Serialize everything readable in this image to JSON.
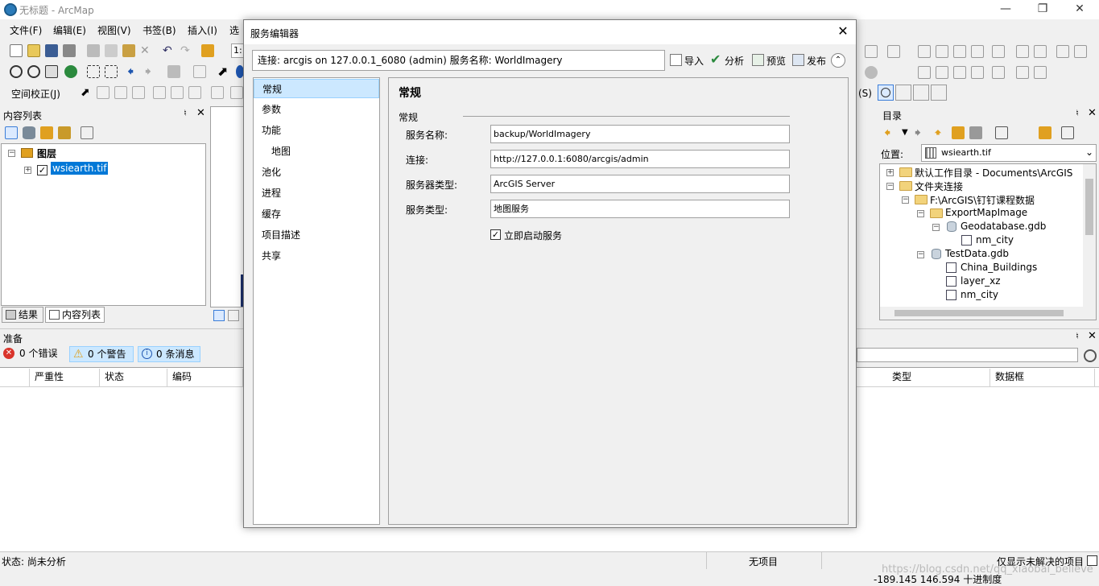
{
  "window": {
    "title": "无标题 - ArcMap"
  },
  "menu": [
    "文件(F)",
    "编辑(E)",
    "视图(V)",
    "书签(B)",
    "插入(I)",
    "选"
  ],
  "toolbar": {
    "scale_value": "1:",
    "spatial_adjust_label": "空间校正(J)",
    "s_label": "(S)"
  },
  "toc": {
    "title": "内容列表",
    "layers_label": "图层",
    "layer_name": "wsiearth.tif",
    "tabs": [
      "结果",
      "内容列表"
    ]
  },
  "prepare": {
    "title": "准备",
    "errors": "0 个错误",
    "warnings": "0 个警告",
    "messages": "0 条消息",
    "columns": [
      "严重性",
      "状态",
      "编码",
      "类型",
      "数据框"
    ]
  },
  "catalog": {
    "title": "目录",
    "location_label": "位置:",
    "location_value": "wsiearth.tif",
    "items": [
      {
        "label": "默认工作目录 - Documents\\ArcGIS"
      },
      {
        "label": "文件夹连接"
      },
      {
        "label": "F:\\ArcGIS\\钉钉课程数据"
      },
      {
        "label": "ExportMapImage"
      },
      {
        "label": "Geodatabase.gdb"
      },
      {
        "label": "nm_city"
      },
      {
        "label": "TestData.gdb"
      },
      {
        "label": "China_Buildings"
      },
      {
        "label": "layer_xz"
      },
      {
        "label": "nm_city"
      }
    ]
  },
  "dialog": {
    "title": "服务编辑器",
    "connection_text": "连接: arcgis on 127.0.0.1_6080 (admin)   服务名称: WorldImagery",
    "tools": {
      "import": "导入",
      "analyze": "分析",
      "preview": "预览",
      "publish": "发布"
    },
    "nav": [
      {
        "label": "常规"
      },
      {
        "label": "参数"
      },
      {
        "label": "功能"
      },
      {
        "label": "地图"
      },
      {
        "label": "池化"
      },
      {
        "label": "进程"
      },
      {
        "label": "缓存"
      },
      {
        "label": "项目描述"
      },
      {
        "label": "共享"
      }
    ],
    "content_title": "常规",
    "group_title": "常规",
    "fields": [
      {
        "label": "服务名称:",
        "value": "backup/WorldImagery"
      },
      {
        "label": "连接:",
        "value": "http://127.0.0.1:6080/arcgis/admin"
      },
      {
        "label": "服务器类型:",
        "value": "ArcGIS Server"
      },
      {
        "label": "服务类型:",
        "value": "地图服务"
      }
    ],
    "start_immediately_label": "立即启动服务",
    "start_immediately_checked": "☑"
  },
  "statusbar": {
    "status": "状态: 尚未分析",
    "no_items": "无项目",
    "show_unresolved": "仅显示未解决的项目",
    "coords": "-189.145  146.594 十进制度"
  },
  "watermark": "https://blog.csdn.net/qq_xiaobai_believe"
}
